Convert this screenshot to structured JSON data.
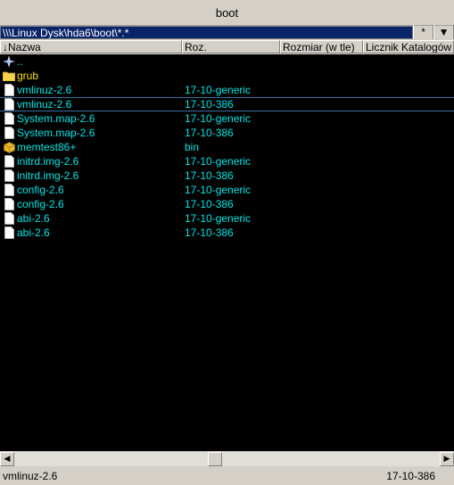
{
  "window": {
    "title": "boot"
  },
  "path": {
    "value": "\\\\\\Linux Dysk\\hda6\\boot\\*.*",
    "star_btn": "*"
  },
  "columns": [
    "↓Nazwa",
    "Roz.",
    "Rozmiar (w tle)",
    "Licznik Katalogów"
  ],
  "rows": [
    {
      "name": "..",
      "ext": "",
      "type": "up"
    },
    {
      "name": "grub",
      "ext": "",
      "type": "folder"
    },
    {
      "name": "vmlinuz-2.6",
      "ext": "17-10-generic",
      "type": "file"
    },
    {
      "name": "vmlinuz-2.6",
      "ext": "17-10-386",
      "type": "file"
    },
    {
      "name": "System.map-2.6",
      "ext": "17-10-generic",
      "type": "file"
    },
    {
      "name": "System.map-2.6",
      "ext": "17-10-386",
      "type": "file"
    },
    {
      "name": "memtest86+",
      "ext": "bin",
      "type": "package"
    },
    {
      "name": "initrd.img-2.6",
      "ext": "17-10-generic",
      "type": "file"
    },
    {
      "name": "initrd.img-2.6",
      "ext": "17-10-386",
      "type": "file"
    },
    {
      "name": "config-2.6",
      "ext": "17-10-generic",
      "type": "file"
    },
    {
      "name": "config-2.6",
      "ext": "17-10-386",
      "type": "file"
    },
    {
      "name": "abi-2.6",
      "ext": "17-10-generic",
      "type": "file"
    },
    {
      "name": "abi-2.6",
      "ext": "17-10-386",
      "type": "file"
    }
  ],
  "cursor_row": 3,
  "status": {
    "name": "vmlinuz-2.6",
    "ext": "17-10-386"
  },
  "colors": {
    "file_text": "#00e6e6",
    "folder_text": "#ffe100",
    "list_bg": "#000000",
    "path_bg": "#0a246a"
  }
}
